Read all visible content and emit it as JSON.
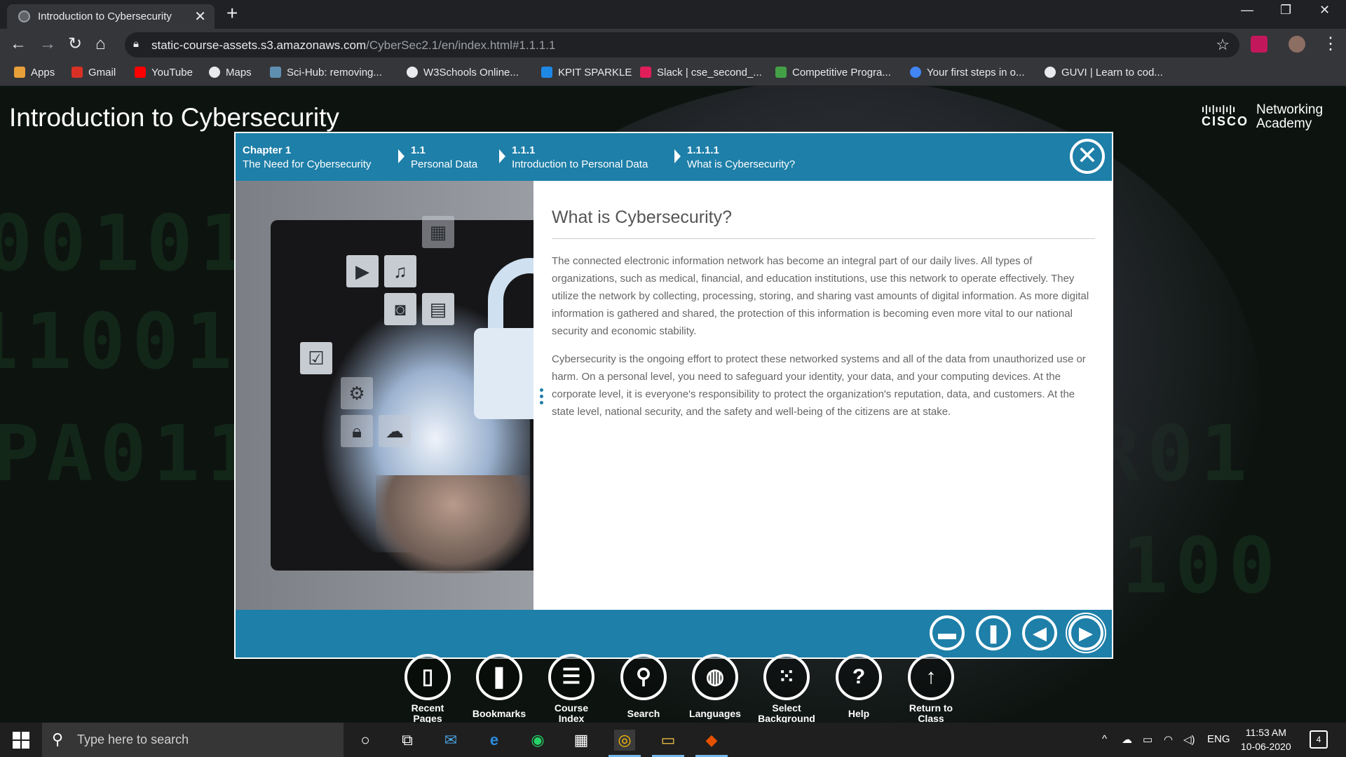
{
  "browser": {
    "tab_title": "Introduction to Cybersecurity",
    "url_host": "static-course-assets.s3.amazonaws.com",
    "url_path": "/CyberSec2.1/en/index.html#1.1.1.1",
    "bookmarks": [
      {
        "label": "Apps",
        "icon": "apps-grid-icon",
        "color": "#e8a03a"
      },
      {
        "label": "Gmail",
        "icon": "gmail-icon",
        "color": "#d93025"
      },
      {
        "label": "YouTube",
        "icon": "youtube-icon",
        "color": "#ff0000"
      },
      {
        "label": "Maps",
        "icon": "globe-icon",
        "color": "#e8eaed"
      },
      {
        "label": "Sci-Hub: removing...",
        "icon": "scihub-icon",
        "color": "#5f8fb0"
      },
      {
        "label": "W3Schools Online...",
        "icon": "globe-icon",
        "color": "#e8eaed"
      },
      {
        "label": "KPIT SPARKLE",
        "icon": "kpit-icon",
        "color": "#1e88e5"
      },
      {
        "label": "Slack | cse_second_...",
        "icon": "slack-icon",
        "color": "#e01e5a"
      },
      {
        "label": "Competitive Progra...",
        "icon": "hackerearth-icon",
        "color": "#43a047"
      },
      {
        "label": "Your first steps in o...",
        "icon": "google-icon",
        "color": "#4285f4"
      },
      {
        "label": "GUVI | Learn to cod...",
        "icon": "globe-icon",
        "color": "#e8eaed"
      }
    ]
  },
  "page": {
    "course_title": "Introduction to Cybersecurity",
    "brand_word": "CISCO",
    "brand_line1": "Networking",
    "brand_line2": "Academy"
  },
  "modal": {
    "breadcrumbs": [
      {
        "num": "Chapter 1",
        "label": "The Need for Cybersecurity"
      },
      {
        "num": "1.1",
        "label": "Personal Data"
      },
      {
        "num": "1.1.1",
        "label": "Introduction to Personal Data"
      },
      {
        "num": "1.1.1.1",
        "label": "What is Cybersecurity?"
      }
    ],
    "heading": "What is Cybersecurity?",
    "paragraph1": "The connected electronic information network has become an integral part of our daily lives. All types of organizations, such as medical, financial, and education institutions, use this network to operate effectively. They utilize the network by collecting, processing, storing, and sharing vast amounts of digital information. As more digital information is gathered and shared, the protection of this information is becoming even more vital to our national security and economic stability.",
    "paragraph2": "Cybersecurity is the ongoing effort to protect these networked systems and all of the data from unauthorized use or harm. On a personal level, you need to safeguard your identity, your data, and your computing devices. At the corporate level, it is everyone's responsibility to protect the organization's reputation, data, and customers. At the state level, national security, and the safety and well-being of the citizens are at stake.",
    "accent_color": "#1e7fa8"
  },
  "course_nav": [
    {
      "label1": "Recent",
      "label2": "Pages",
      "icon": "recent-pages-icon"
    },
    {
      "label1": "Bookmarks",
      "label2": "",
      "icon": "bookmark-icon"
    },
    {
      "label1": "Course",
      "label2": "Index",
      "icon": "menu-list-icon"
    },
    {
      "label1": "Search",
      "label2": "",
      "icon": "search-icon"
    },
    {
      "label1": "Languages",
      "label2": "",
      "icon": "globe-icon"
    },
    {
      "label1": "Select",
      "label2": "Background",
      "icon": "grid-dots-icon"
    },
    {
      "label1": "Help",
      "label2": "",
      "icon": "help-icon"
    },
    {
      "label1": "Return to",
      "label2": "Class",
      "icon": "arrow-up-icon"
    }
  ],
  "taskbar": {
    "search_placeholder": "Type here to search",
    "language": "ENG",
    "time": "11:53 AM",
    "date": "10-06-2020",
    "notifications": "4"
  }
}
